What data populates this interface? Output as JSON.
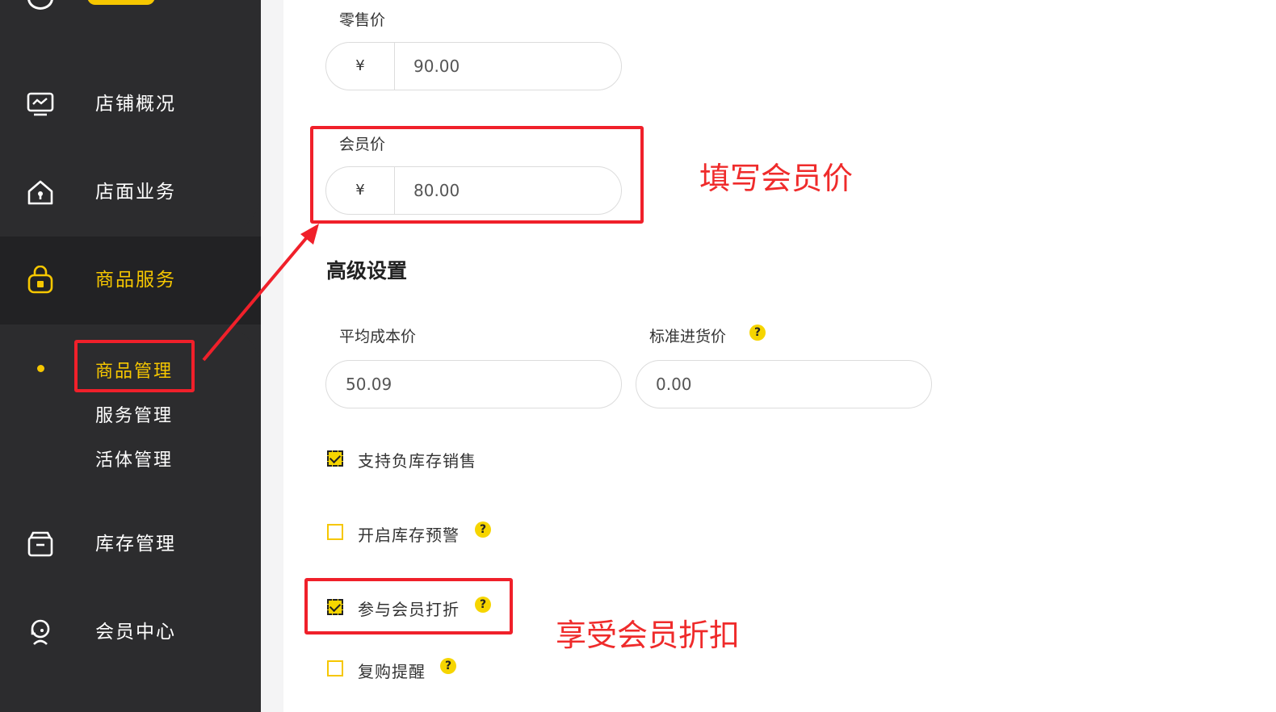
{
  "sidebar": {
    "items": [
      {
        "label": "店铺概况",
        "icon": "monitor-icon"
      },
      {
        "label": "店面业务",
        "icon": "home-icon"
      },
      {
        "label": "商品服务",
        "icon": "shopping-bag-icon"
      },
      {
        "label": "库存管理",
        "icon": "archive-box-icon"
      },
      {
        "label": "会员中心",
        "icon": "member-headset-icon"
      }
    ],
    "sub_items": [
      {
        "label": "商品管理"
      },
      {
        "label": "服务管理"
      },
      {
        "label": "活体管理"
      }
    ],
    "accent_color": "#f6c700",
    "background_color": "#2c2c2e"
  },
  "form": {
    "retail_price": {
      "label": "零售价",
      "currency": "¥",
      "value": "90.00"
    },
    "member_price": {
      "label": "会员价",
      "currency": "¥",
      "value": "80.00"
    },
    "advanced_title": "高级设置",
    "avg_cost": {
      "label": "平均成本价",
      "value": "50.09"
    },
    "std_purchase": {
      "label": "标准进货价",
      "value": "0.00"
    },
    "options": [
      {
        "label": "支持负库存销售",
        "checked": true,
        "help": false
      },
      {
        "label": "开启库存预警",
        "checked": false,
        "help": true
      },
      {
        "label": "参与会员打折",
        "checked": true,
        "help": true
      },
      {
        "label": "复购提醒",
        "checked": false,
        "help": true
      }
    ],
    "help_mark": "?"
  },
  "annotations": {
    "member_price_note": "填写会员价",
    "discount_note": "享受会员折扣",
    "color": "#f0202a"
  }
}
